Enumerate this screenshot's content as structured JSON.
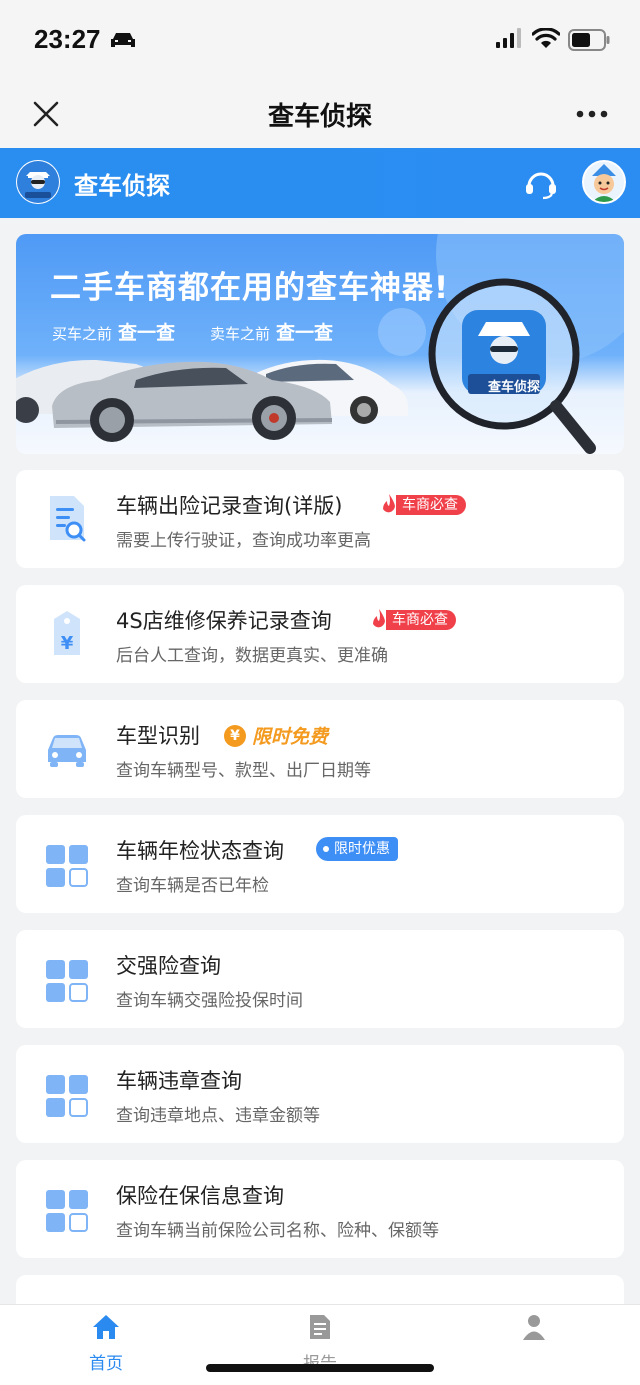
{
  "status_bar": {
    "time": "23:27"
  },
  "nav": {
    "title": "查车侦探"
  },
  "brand": {
    "name": "查车侦探",
    "logo_text": "查车侦探"
  },
  "banner": {
    "title": "二手车商都在用的查车神器!",
    "buy_prefix": "买车之前",
    "buy_action": "查一查",
    "sell_prefix": "卖车之前",
    "sell_action": "查一查",
    "magnifier_label": "查车侦探"
  },
  "services": [
    {
      "title": "车辆出险记录查询(详版)",
      "desc": "需要上传行驶证，查询成功率更高",
      "badge": "车商必查",
      "badge_type": "hot",
      "icon": "document-search-icon"
    },
    {
      "title": "4S店维修保养记录查询",
      "desc": "后台人工查询，数据更真实、更准确",
      "badge": "车商必查",
      "badge_type": "hot",
      "icon": "yen-tag-icon"
    },
    {
      "title": "车型识别",
      "desc": "查询车辆型号、款型、出厂日期等",
      "badge": "限时免费",
      "badge_type": "free",
      "icon": "car-icon"
    },
    {
      "title": "车辆年检状态查询",
      "desc": "查询车辆是否已年检",
      "badge": "限时优惠",
      "badge_type": "discount",
      "icon": "grid-icon"
    },
    {
      "title": "交强险查询",
      "desc": "查询车辆交强险投保时间",
      "icon": "grid-icon"
    },
    {
      "title": "车辆违章查询",
      "desc": "查询违章地点、违章金额等",
      "icon": "grid-icon"
    },
    {
      "title": "保险在保信息查询",
      "desc": "查询车辆当前保险公司名称、险种、保额等",
      "icon": "grid-icon"
    }
  ],
  "tabs": [
    {
      "label": "首页",
      "icon": "home-icon",
      "active": true
    },
    {
      "label": "报告",
      "icon": "report-icon",
      "active": false
    },
    {
      "label": "",
      "icon": "user-icon",
      "active": false
    }
  ],
  "colors": {
    "brand_blue": "#2b8df2",
    "hot_red": "#f0414b",
    "free_orange": "#f39a1f",
    "discount_blue": "#3d8ef5"
  }
}
